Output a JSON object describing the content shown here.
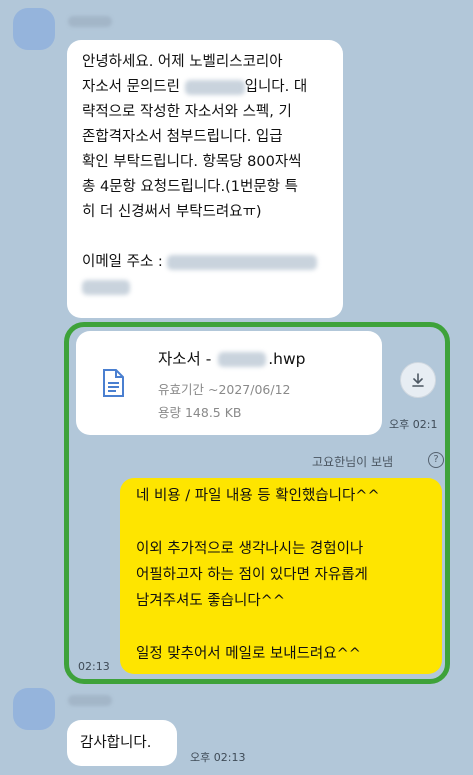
{
  "message1": {
    "lines": [
      "안녕하세요. 어제 노벨리스코리아",
      "자소서 문의드린",
      "입니다. 대",
      "략적으로 작성한 자소서와 스펙, 기",
      "존합격자소서 첨부드립니다. 입급",
      "확인 부탁드립니다. 항목당 800자씩",
      "총 4문항 요청드립니다.(1번문항 특",
      "히 더 신경써서 부탁드려요ㅠ)",
      "이메일 주소 :"
    ]
  },
  "file": {
    "name_prefix": "자소서 - ",
    "name_ext": ".hwp",
    "expiry": "유효기간 ~2027/06/12",
    "size": "용량 148.5 KB",
    "time": "오후 02:1"
  },
  "sender_note": "고요한님이 보냄",
  "reply": {
    "line1": "네 비용 / 파일 내용 등 확인했습니다^^",
    "line2": "이외 추가적으로 생각나시는 경험이나",
    "line3": "어필하고자 하는 점이 있다면 자유롭게",
    "line4": "남겨주셔도 좋습니다^^",
    "line5": "일정 맞추어서 메일로 보내드려요^^",
    "time": "02:13"
  },
  "message_last": {
    "text": "감사합니다.",
    "time": "오후 02:13"
  },
  "colors": {
    "background": "#b2c7d9",
    "my_bubble": "#fee500",
    "highlight_border": "#3ea23a"
  }
}
